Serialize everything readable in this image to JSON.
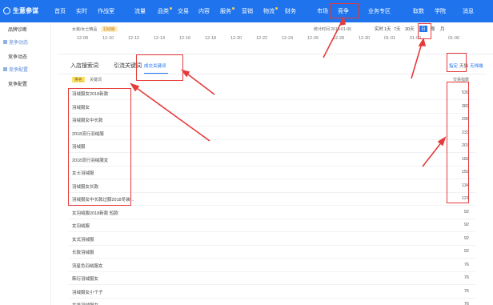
{
  "brand": {
    "title": "生意参谋"
  },
  "topnav": {
    "items": [
      {
        "label": "首页",
        "dot": false
      },
      {
        "label": "实时",
        "dot": false
      },
      {
        "label": "作战室",
        "dot": false
      },
      {
        "label": "流量",
        "dot": false
      },
      {
        "label": "品类",
        "dot": true
      },
      {
        "label": "交易",
        "dot": false
      },
      {
        "label": "内容",
        "dot": false
      },
      {
        "label": "服务",
        "dot": true
      },
      {
        "label": "营销",
        "dot": false
      },
      {
        "label": "物流",
        "dot": true
      },
      {
        "label": "财务",
        "dot": false
      },
      {
        "label": "市场",
        "dot": false
      },
      {
        "label": "竞争",
        "dot": false
      },
      {
        "label": "业务专区",
        "dot": false
      },
      {
        "label": "取数",
        "dot": false
      },
      {
        "label": "学院",
        "dot": false
      },
      {
        "label": "消息",
        "dot": false
      }
    ]
  },
  "sidebar": {
    "items": [
      {
        "label": "品牌诊断",
        "group": false
      },
      {
        "label": "竞争动态",
        "group": true
      },
      {
        "label": "竞争动态",
        "group": false
      },
      {
        "label": "竞争配置",
        "group": true
      },
      {
        "label": "竞争配置",
        "group": false
      }
    ]
  },
  "filterbar": {
    "category": "女装/女士精品",
    "category_badge": "羽绒服",
    "stat_time": "统计时间 2019-01-06",
    "periods": [
      "实时",
      "1天",
      "7天",
      "30天",
      "日",
      "周",
      "月"
    ],
    "active_period": "日",
    "dates": [
      "12-08",
      "12-10",
      "12-12",
      "12-14",
      "12-16",
      "12-18",
      "12-20",
      "12-22",
      "12-24",
      "12-26",
      "12-28",
      "12-30",
      "01-01",
      "01-03",
      "01-06"
    ]
  },
  "panel": {
    "tabs": [
      "入店搜索词",
      "引流关键词",
      "成交关键词"
    ],
    "active_tab": "成交关键词",
    "options": [
      "指定",
      "天猫",
      "无线端"
    ],
    "rank_header": "排名",
    "kw_header": "关键词",
    "idx_header": "交易指数",
    "rows": [
      {
        "kw": "羽绒服女2018新款",
        "val": "539"
      },
      {
        "kw": "羽绒服女",
        "val": "382"
      },
      {
        "kw": "羽绒服女中长款",
        "val": "296"
      },
      {
        "kw": "2018流行羽绒服",
        "val": "233"
      },
      {
        "kw": "羽绒服",
        "val": "203"
      },
      {
        "kw": "2018流行羽绒服女",
        "val": "182"
      },
      {
        "kw": "女士羽绒服",
        "val": "159"
      },
      {
        "kw": "羽绒服女长款",
        "val": "134"
      },
      {
        "kw": "羽绒服女中长款过膝2018冬装...",
        "val": "121"
      },
      {
        "kw": "女羽绒服2018新款 短款",
        "val": "92"
      },
      {
        "kw": "女羽绒服",
        "val": "92"
      },
      {
        "kw": "女式羽绒服",
        "val": "92"
      },
      {
        "kw": "长款羽绒服",
        "val": "92"
      },
      {
        "kw": "流星色羽绒服女",
        "val": "76"
      },
      {
        "kw": "韩衍羽绒服女",
        "val": "76"
      },
      {
        "kw": "羽绒服女小个子",
        "val": "76"
      },
      {
        "kw": "女装羽绒服女",
        "val": "76"
      }
    ]
  },
  "colors": {
    "brand_blue": "#1f74ee",
    "highlight_red": "#e53b3b"
  }
}
